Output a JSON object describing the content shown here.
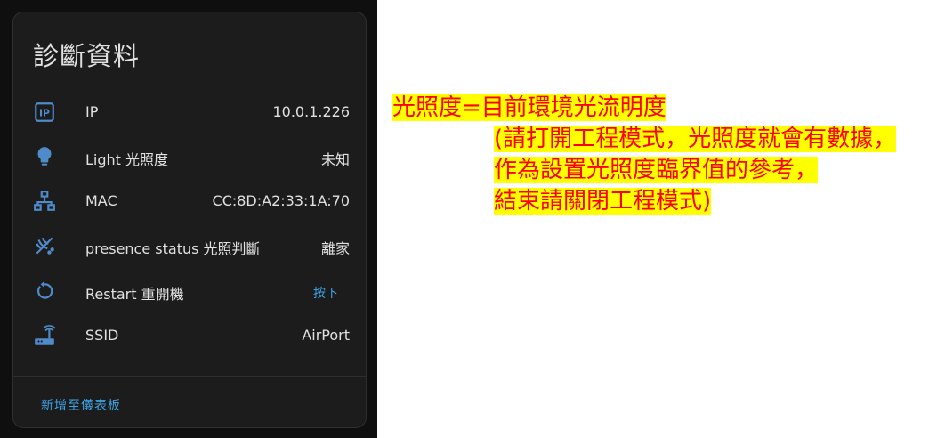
{
  "card": {
    "title": "診斷資料",
    "rows": [
      {
        "icon": "ip-icon",
        "label": "IP",
        "value": "10.0.1.226"
      },
      {
        "icon": "lightbulb-icon",
        "label": "Light 光照度",
        "value": "未知"
      },
      {
        "icon": "network-icon",
        "label": "MAC",
        "value": "CC:8D:A2:33:1A:70"
      },
      {
        "icon": "motion-sensor-icon",
        "label": "presence status 光照判斷",
        "value": "離家"
      },
      {
        "icon": "restart-icon",
        "label": "Restart 重開機",
        "action": "按下"
      },
      {
        "icon": "router-wifi-icon",
        "label": "SSID",
        "value": "AirPort"
      }
    ],
    "footer_button": "新增至儀表板"
  },
  "annotation": {
    "lines": [
      "光照度=目前環境光流明度",
      "(請打開工程模式，光照度就會有數據，",
      "作為設置光照度臨界值的參考，",
      "結束請關閉工程模式)"
    ],
    "text_color": "#ff0000",
    "highlight_color": "#ffff00"
  },
  "colors": {
    "card_bg": "#1c1c1c",
    "icon": "#4f8ac9",
    "accent": "#3ba3e6"
  }
}
